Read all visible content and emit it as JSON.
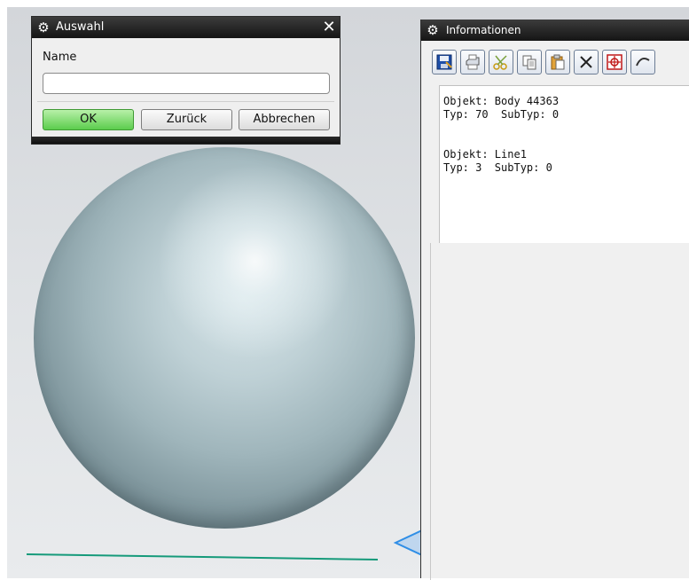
{
  "auswahl_dialog": {
    "title": "Auswahl",
    "name_label": "Name",
    "name_value": "",
    "ok_label": "OK",
    "back_label": "Zurück",
    "cancel_label": "Abbrechen",
    "close_glyph": "✕"
  },
  "info_window": {
    "title": "Informationen",
    "text": "Objekt: Body 44363\nTyp: 70  SubTyp: 0\n\n\nObjekt: Line1\nTyp: 3  SubTyp: 0",
    "toolbar_icons": [
      "save-icon",
      "print-icon",
      "cut-icon",
      "copy-icon",
      "paste-icon",
      "delete-icon",
      "target-icon",
      "curve-icon"
    ]
  },
  "colors": {
    "title_bar": "#1c1c1c",
    "ok_button": "#6fd25f",
    "line": "#159a7a",
    "axis_arrow": "#2f8ee6"
  }
}
